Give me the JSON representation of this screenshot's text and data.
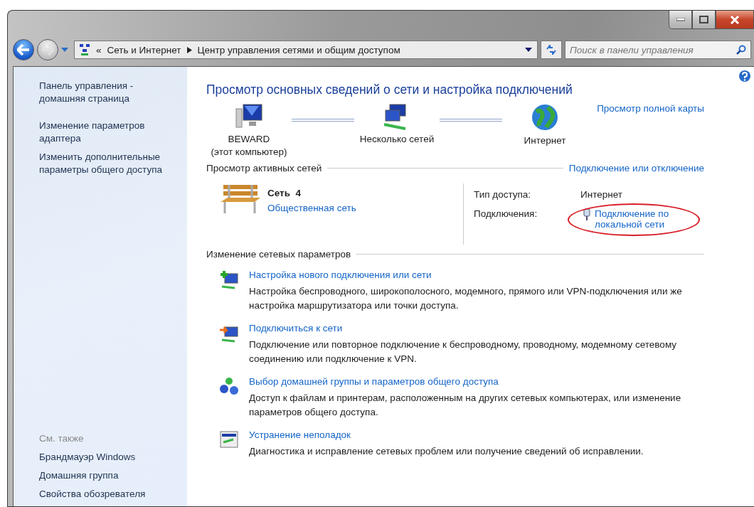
{
  "window": {
    "controls": [
      {
        "kind": "minimize"
      },
      {
        "kind": "maximize"
      },
      {
        "kind": "close"
      }
    ]
  },
  "address": {
    "overflow": "«",
    "breadcrumb": [
      "Сеть и Интернет",
      "Центр управления сетями и общим доступом"
    ]
  },
  "search": {
    "placeholder": "Поиск в панели управления"
  },
  "sidebar": {
    "items": [
      "Панель управления - домашняя страница",
      "Изменение параметров адаптера",
      "Изменить дополнительные параметры общего доступа"
    ],
    "see_also_heading": "См. также",
    "see_also": [
      "Брандмауэр Windows",
      "Домашняя группа",
      "Свойства обозревателя"
    ]
  },
  "main": {
    "title": "Просмотр основных сведений о сети и настройка подключений",
    "map_link": "Просмотр полной карты",
    "map_nodes": [
      {
        "kind": "computer",
        "label": "BEWARD",
        "sublabel": "(этот компьютер)"
      },
      {
        "kind": "network",
        "label": "Несколько сетей"
      },
      {
        "kind": "internet",
        "label": "Интернет"
      }
    ],
    "active_heading": "Просмотр активных сетей",
    "active_link": "Подключение или отключение",
    "network": {
      "name": "Сеть  4",
      "type": "Общественная сеть",
      "access_label": "Тип доступа:",
      "access_value": "Интернет",
      "connections_label": "Подключения:",
      "connection_link": "Подключение по локальной сети",
      "highlighted": true
    },
    "change_heading": "Изменение сетевых параметров",
    "tasks": [
      {
        "kind": "new",
        "title": "Настройка нового подключения или сети",
        "description": "Настройка беспроводного, широкополосного, модемного, прямого или VPN-подключения или же настройка маршрутизатора или точки доступа."
      },
      {
        "kind": "connect",
        "title": "Подключиться к сети",
        "description": "Подключение или повторное подключение к беспроводному, проводному, модемному сетевому соединению или подключение к VPN."
      },
      {
        "kind": "homegroup",
        "title": "Выбор домашней группы и параметров общего доступа",
        "description": "Доступ к файлам и принтерам, расположенным на других сетевых компьютерах, или изменение параметров общего доступа."
      },
      {
        "kind": "troubleshoot",
        "title": "Устранение неполадок",
        "description": "Диагностика и исправление сетевых проблем или получение сведений об исправлении."
      }
    ]
  }
}
